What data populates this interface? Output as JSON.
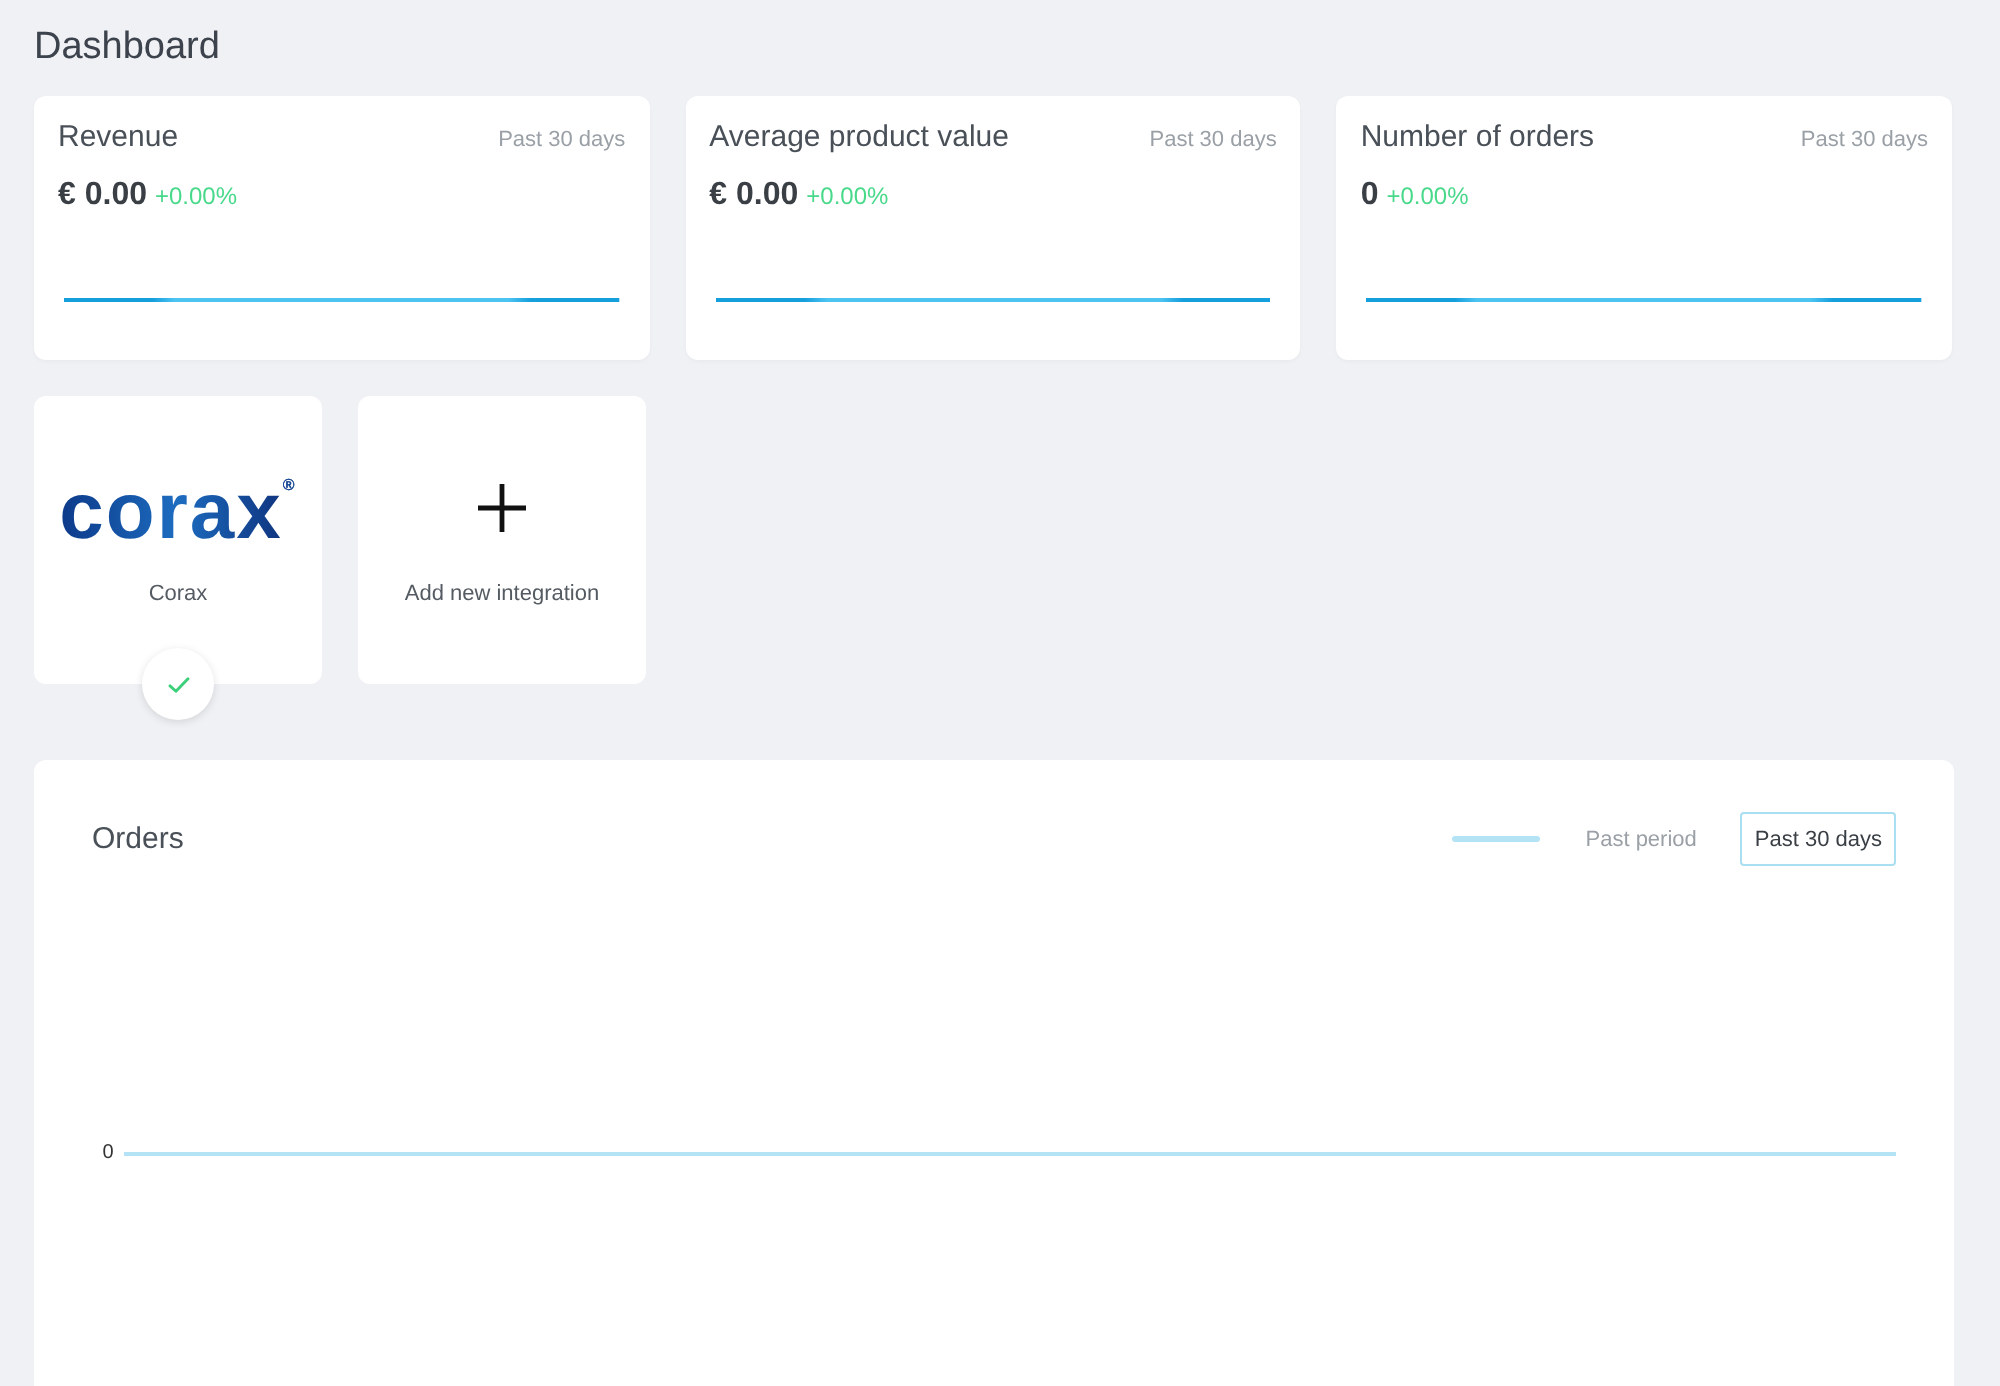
{
  "page": {
    "title": "Dashboard"
  },
  "metrics": [
    {
      "title": "Revenue",
      "period": "Past 30 days",
      "value": "€ 0.00",
      "change": "+0.00%"
    },
    {
      "title": "Average product value",
      "period": "Past 30 days",
      "value": "€ 0.00",
      "change": "+0.00%"
    },
    {
      "title": "Number of orders",
      "period": "Past 30 days",
      "value": "0",
      "change": "+0.00%"
    }
  ],
  "integrations": [
    {
      "kind": "integration",
      "logo_text": "corax",
      "logo_mark": "®",
      "name": "Corax",
      "connected": true
    },
    {
      "kind": "add",
      "label": "Add new integration"
    }
  ],
  "orders_panel": {
    "title": "Orders",
    "legend_label": "Past period",
    "period_button": "Past 30 days",
    "y_axis_label": "0"
  }
}
